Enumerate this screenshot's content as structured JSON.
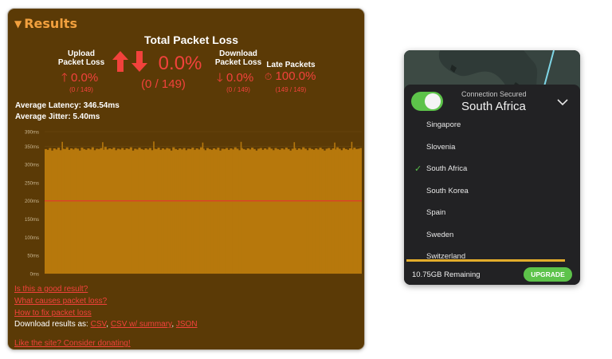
{
  "results": {
    "title": "Results",
    "total": {
      "label": "Total Packet Loss",
      "value": "0.0%",
      "fraction": "(0 / 149)"
    },
    "upload": {
      "label1": "Upload",
      "label2": "Packet Loss",
      "value": "0.0%",
      "fraction": "(0 / 149)"
    },
    "download": {
      "label1": "Download",
      "label2": "Packet Loss",
      "value": "0.0%",
      "fraction": "(0 / 149)"
    },
    "late": {
      "label": "Late Packets",
      "value": "100.0%",
      "fraction": "(149 / 149)"
    },
    "avg_latency": "Average Latency: 346.54ms",
    "avg_jitter": "Average Jitter: 5.40ms",
    "links": {
      "good_result": "Is this a good result?",
      "causes": "What causes packet loss?",
      "fix": "How to fix packet loss"
    },
    "download_results": {
      "prefix": "Download results as:",
      "csv": "CSV",
      "csv_summary": "CSV w/ summary",
      "json": "JSON"
    },
    "donate": "Like the site? Consider donating!"
  },
  "chart_data": {
    "type": "bar",
    "y_tick_labels": [
      "0ms",
      "50ms",
      "100ms",
      "150ms",
      "200ms",
      "250ms",
      "300ms",
      "350ms",
      "390ms"
    ],
    "y_ticks": [
      0,
      50,
      100,
      150,
      200,
      250,
      300,
      350,
      390
    ],
    "ylim": [
      0,
      390
    ],
    "threshold_line": 200,
    "n_packets": 149,
    "values": [
      342,
      340,
      345,
      338,
      344,
      341,
      346,
      339,
      343,
      342,
      347,
      340,
      344,
      341,
      345,
      343,
      338,
      346,
      342,
      340,
      344,
      341,
      347,
      339,
      343,
      342,
      345,
      340,
      348,
      341,
      344,
      342,
      346,
      339,
      343,
      341,
      345,
      340,
      344,
      342,
      347,
      338,
      343,
      341,
      346,
      342,
      340,
      344,
      341,
      345,
      339,
      343,
      342,
      346,
      340,
      344,
      341,
      345,
      343,
      338,
      347,
      342,
      340,
      344,
      341,
      345,
      339,
      343,
      342,
      346,
      340,
      344,
      341,
      347,
      343,
      339,
      345,
      342,
      340,
      344,
      341,
      346,
      338,
      343,
      342,
      345,
      340,
      344,
      341,
      347,
      343,
      339,
      345,
      342,
      340,
      344,
      341,
      346,
      342,
      338,
      343,
      345,
      340,
      344,
      341,
      347,
      343,
      339,
      345,
      342,
      340,
      344,
      341,
      346,
      342,
      338,
      343,
      345,
      340,
      344,
      341,
      347,
      343,
      339,
      345,
      342,
      340,
      344,
      341,
      346,
      342,
      338,
      343,
      345,
      340,
      344,
      341,
      347,
      343,
      339,
      345,
      342,
      340,
      344,
      341,
      346,
      342,
      343,
      345
    ],
    "spikes": [
      [
        8,
        362
      ],
      [
        27,
        361
      ],
      [
        51,
        363
      ],
      [
        74,
        360
      ],
      [
        92,
        362
      ],
      [
        117,
        361
      ],
      [
        136,
        360
      ],
      [
        144,
        362
      ]
    ],
    "bar_color": "#b7780c",
    "threshold_color": "#e03a2c"
  },
  "vpn": {
    "status": "Connection Secured",
    "country": "South Africa",
    "toggle_on": true,
    "locations": [
      {
        "name": "Singapore",
        "selected": false
      },
      {
        "name": "Slovenia",
        "selected": false
      },
      {
        "name": "South Africa",
        "selected": true
      },
      {
        "name": "South Korea",
        "selected": false
      },
      {
        "name": "Spain",
        "selected": false
      },
      {
        "name": "Sweden",
        "selected": false
      },
      {
        "name": "Switzerland",
        "selected": false
      }
    ],
    "check_glyph": "✓",
    "data_used_fraction": 1.0,
    "remaining": "10.75GB Remaining",
    "upgrade": "UPGRADE"
  },
  "colors": {
    "panel_bg": "#5b3a06",
    "accent_red": "#f2423c",
    "title_orange": "#f2a03e",
    "vpn_green": "#5dc34a",
    "vpn_bar": "#e3ad2b"
  }
}
